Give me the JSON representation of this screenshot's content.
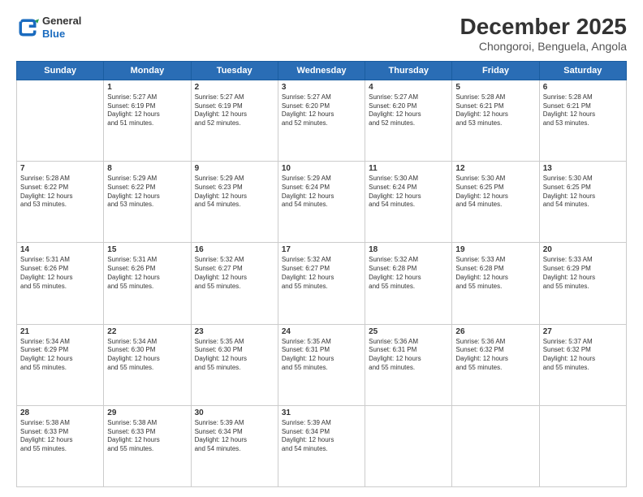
{
  "header": {
    "logo_line1": "General",
    "logo_line2": "Blue",
    "title": "December 2025",
    "subtitle": "Chongoroi, Benguela, Angola"
  },
  "days_of_week": [
    "Sunday",
    "Monday",
    "Tuesday",
    "Wednesday",
    "Thursday",
    "Friday",
    "Saturday"
  ],
  "weeks": [
    [
      {
        "num": "",
        "info": ""
      },
      {
        "num": "1",
        "info": "Sunrise: 5:27 AM\nSunset: 6:19 PM\nDaylight: 12 hours\nand 51 minutes."
      },
      {
        "num": "2",
        "info": "Sunrise: 5:27 AM\nSunset: 6:19 PM\nDaylight: 12 hours\nand 52 minutes."
      },
      {
        "num": "3",
        "info": "Sunrise: 5:27 AM\nSunset: 6:20 PM\nDaylight: 12 hours\nand 52 minutes."
      },
      {
        "num": "4",
        "info": "Sunrise: 5:27 AM\nSunset: 6:20 PM\nDaylight: 12 hours\nand 52 minutes."
      },
      {
        "num": "5",
        "info": "Sunrise: 5:28 AM\nSunset: 6:21 PM\nDaylight: 12 hours\nand 53 minutes."
      },
      {
        "num": "6",
        "info": "Sunrise: 5:28 AM\nSunset: 6:21 PM\nDaylight: 12 hours\nand 53 minutes."
      }
    ],
    [
      {
        "num": "7",
        "info": "Sunrise: 5:28 AM\nSunset: 6:22 PM\nDaylight: 12 hours\nand 53 minutes."
      },
      {
        "num": "8",
        "info": "Sunrise: 5:29 AM\nSunset: 6:22 PM\nDaylight: 12 hours\nand 53 minutes."
      },
      {
        "num": "9",
        "info": "Sunrise: 5:29 AM\nSunset: 6:23 PM\nDaylight: 12 hours\nand 54 minutes."
      },
      {
        "num": "10",
        "info": "Sunrise: 5:29 AM\nSunset: 6:24 PM\nDaylight: 12 hours\nand 54 minutes."
      },
      {
        "num": "11",
        "info": "Sunrise: 5:30 AM\nSunset: 6:24 PM\nDaylight: 12 hours\nand 54 minutes."
      },
      {
        "num": "12",
        "info": "Sunrise: 5:30 AM\nSunset: 6:25 PM\nDaylight: 12 hours\nand 54 minutes."
      },
      {
        "num": "13",
        "info": "Sunrise: 5:30 AM\nSunset: 6:25 PM\nDaylight: 12 hours\nand 54 minutes."
      }
    ],
    [
      {
        "num": "14",
        "info": "Sunrise: 5:31 AM\nSunset: 6:26 PM\nDaylight: 12 hours\nand 55 minutes."
      },
      {
        "num": "15",
        "info": "Sunrise: 5:31 AM\nSunset: 6:26 PM\nDaylight: 12 hours\nand 55 minutes."
      },
      {
        "num": "16",
        "info": "Sunrise: 5:32 AM\nSunset: 6:27 PM\nDaylight: 12 hours\nand 55 minutes."
      },
      {
        "num": "17",
        "info": "Sunrise: 5:32 AM\nSunset: 6:27 PM\nDaylight: 12 hours\nand 55 minutes."
      },
      {
        "num": "18",
        "info": "Sunrise: 5:32 AM\nSunset: 6:28 PM\nDaylight: 12 hours\nand 55 minutes."
      },
      {
        "num": "19",
        "info": "Sunrise: 5:33 AM\nSunset: 6:28 PM\nDaylight: 12 hours\nand 55 minutes."
      },
      {
        "num": "20",
        "info": "Sunrise: 5:33 AM\nSunset: 6:29 PM\nDaylight: 12 hours\nand 55 minutes."
      }
    ],
    [
      {
        "num": "21",
        "info": "Sunrise: 5:34 AM\nSunset: 6:29 PM\nDaylight: 12 hours\nand 55 minutes."
      },
      {
        "num": "22",
        "info": "Sunrise: 5:34 AM\nSunset: 6:30 PM\nDaylight: 12 hours\nand 55 minutes."
      },
      {
        "num": "23",
        "info": "Sunrise: 5:35 AM\nSunset: 6:30 PM\nDaylight: 12 hours\nand 55 minutes."
      },
      {
        "num": "24",
        "info": "Sunrise: 5:35 AM\nSunset: 6:31 PM\nDaylight: 12 hours\nand 55 minutes."
      },
      {
        "num": "25",
        "info": "Sunrise: 5:36 AM\nSunset: 6:31 PM\nDaylight: 12 hours\nand 55 minutes."
      },
      {
        "num": "26",
        "info": "Sunrise: 5:36 AM\nSunset: 6:32 PM\nDaylight: 12 hours\nand 55 minutes."
      },
      {
        "num": "27",
        "info": "Sunrise: 5:37 AM\nSunset: 6:32 PM\nDaylight: 12 hours\nand 55 minutes."
      }
    ],
    [
      {
        "num": "28",
        "info": "Sunrise: 5:38 AM\nSunset: 6:33 PM\nDaylight: 12 hours\nand 55 minutes."
      },
      {
        "num": "29",
        "info": "Sunrise: 5:38 AM\nSunset: 6:33 PM\nDaylight: 12 hours\nand 55 minutes."
      },
      {
        "num": "30",
        "info": "Sunrise: 5:39 AM\nSunset: 6:34 PM\nDaylight: 12 hours\nand 54 minutes."
      },
      {
        "num": "31",
        "info": "Sunrise: 5:39 AM\nSunset: 6:34 PM\nDaylight: 12 hours\nand 54 minutes."
      },
      {
        "num": "",
        "info": ""
      },
      {
        "num": "",
        "info": ""
      },
      {
        "num": "",
        "info": ""
      }
    ]
  ]
}
